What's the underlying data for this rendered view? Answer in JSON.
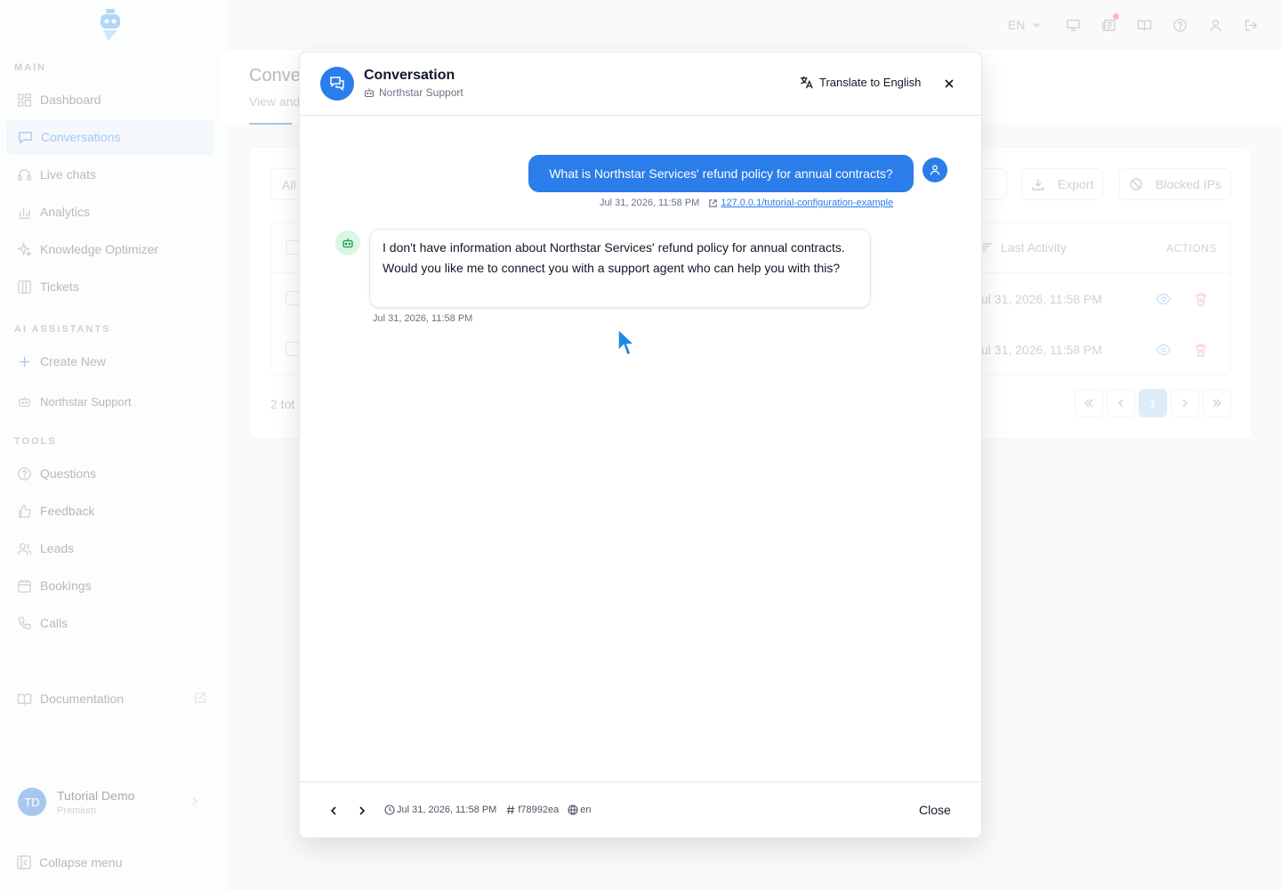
{
  "sidebar": {
    "sections": {
      "main": "MAIN",
      "assistants": "AI ASSISTANTS",
      "tools": "TOOLS"
    },
    "main_items": [
      "Dashboard",
      "Conversations",
      "Live chats",
      "Analytics",
      "Knowledge Optimizer",
      "Tickets"
    ],
    "assistant_items": [
      "Create New",
      "Northstar Support"
    ],
    "tool_items": [
      "Questions",
      "Feedback",
      "Leads",
      "Bookings",
      "Calls"
    ],
    "documentation": "Documentation",
    "user": {
      "initials": "TD",
      "name": "Tutorial Demo",
      "plan": "Premium"
    },
    "collapse": "Collapse menu"
  },
  "topbar": {
    "language": "EN"
  },
  "page": {
    "title": "Conve",
    "subtitle": "View and",
    "filter": "All",
    "export": "Export",
    "blocked_ips": "Blocked IPs",
    "col_last_activity": "Last Activity",
    "col_actions": "ACTIONS",
    "rows": [
      "ul 31, 2026, 11:58 PM",
      "ul 31, 2026, 11:58 PM"
    ],
    "total": "2 tot",
    "pagination": {
      "current": "1"
    }
  },
  "modal": {
    "title": "Conversation",
    "assistant": "Northstar Support",
    "translate": "Translate to English",
    "user_message": "What is Northstar Services' refund policy for annual contracts?",
    "user_time": "Jul 31, 2026, 11:58 PM",
    "user_source": "127.0.0.1/tutorial-configuration-example",
    "bot_message": "I don't have information about Northstar Services' refund policy for annual contracts. Would you like me to connect you with a support agent who can help you with this?",
    "bot_time": "Jul 31, 2026, 11:58 PM",
    "footer": {
      "time": "Jul 31, 2026, 11:58 PM",
      "id": "f78992ea",
      "lang": "en",
      "close": "Close"
    }
  },
  "colors": {
    "accent": "#2b7de9",
    "bot_bg": "#d9f5e6",
    "danger": "#f87171"
  }
}
